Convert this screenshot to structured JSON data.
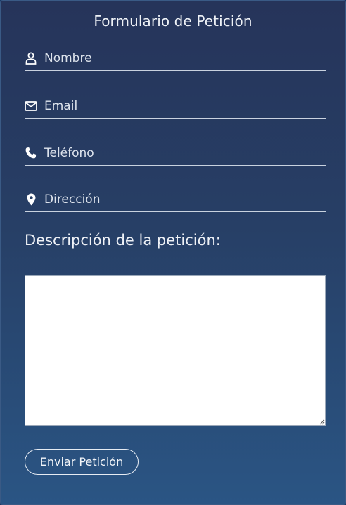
{
  "form": {
    "title": "Formulario de Petición",
    "fields": [
      {
        "name": "nombre",
        "icon": "user-icon",
        "placeholder": "Nombre",
        "value": ""
      },
      {
        "name": "email",
        "icon": "envelope-icon",
        "placeholder": "Email",
        "value": ""
      },
      {
        "name": "telefono",
        "icon": "phone-icon",
        "placeholder": "Teléfono",
        "value": ""
      },
      {
        "name": "direccion",
        "icon": "map-pin-icon",
        "placeholder": "Dirección",
        "value": ""
      }
    ],
    "description_label": "Descripción de la petición:",
    "description_value": "",
    "submit_label": "Enviar Petición"
  },
  "colors": {
    "gradient_top": "#26345a",
    "gradient_bottom": "#2a5584",
    "text": "#eef1f6",
    "underline": "#c9d2df"
  }
}
